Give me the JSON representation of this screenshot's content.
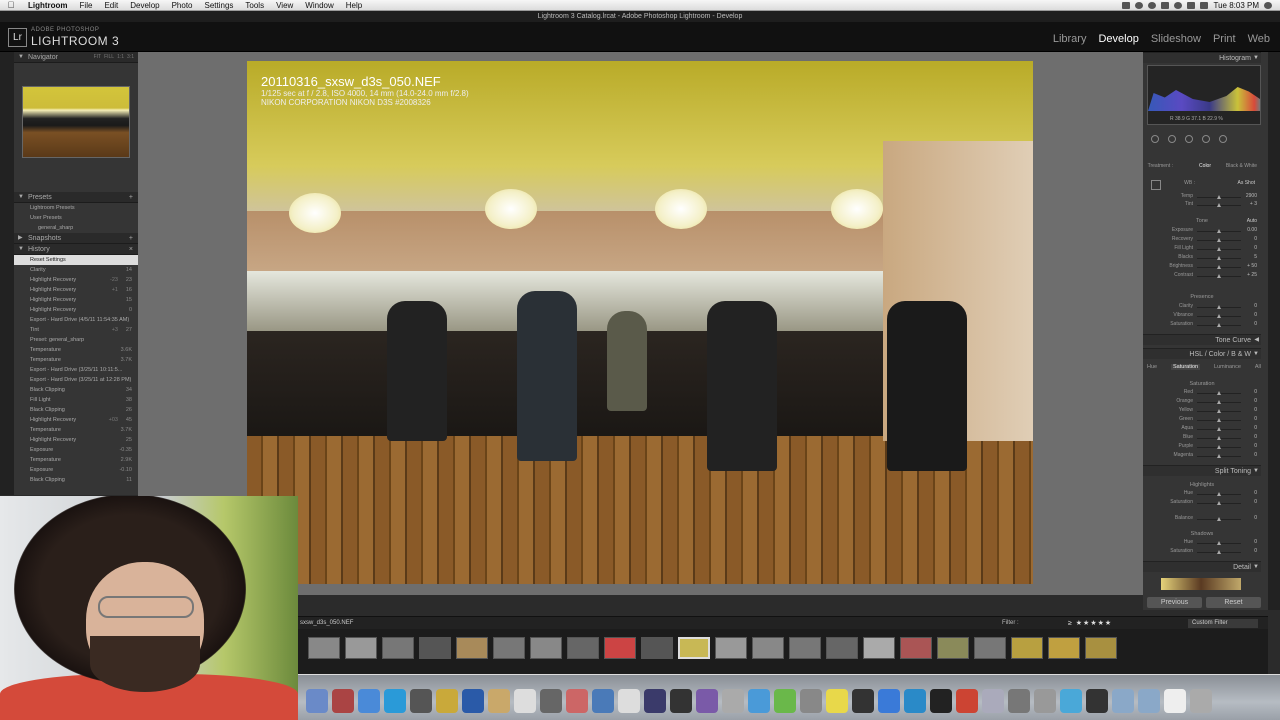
{
  "menubar": {
    "app": "Lightroom",
    "items": [
      "File",
      "Edit",
      "Develop",
      "Photo",
      "Settings",
      "Tools",
      "View",
      "Window",
      "Help"
    ],
    "clock": "Tue 8:03 PM"
  },
  "window": {
    "title": "Lightroom 3 Catalog.lrcat - Adobe Photoshop Lightroom - Develop"
  },
  "identity": {
    "small": "ADOBE PHOTOSHOP",
    "big": "LIGHTROOM 3",
    "logo": "Lr"
  },
  "modules": {
    "library": "Library",
    "develop": "Develop",
    "slideshow": "Slideshow",
    "print": "Print",
    "web": "Web"
  },
  "navigator": {
    "title": "Navigator",
    "fit": "FIT",
    "fill": "FILL",
    "one": "1:1",
    "ratio": "3:1"
  },
  "presets": {
    "title": "Presets",
    "items": [
      "Lightroom Presets",
      "User Presets",
      "general_sharp"
    ]
  },
  "snapshots": {
    "title": "Snapshots"
  },
  "history": {
    "title": "History",
    "items": [
      {
        "label": "Reset Settings",
        "v1": "",
        "v2": ""
      },
      {
        "label": "Clarity",
        "v1": "",
        "v2": "14"
      },
      {
        "label": "Highlight Recovery",
        "v1": "-23",
        "v2": "23"
      },
      {
        "label": "Highlight Recovery",
        "v1": "+1",
        "v2": "16"
      },
      {
        "label": "Highlight Recovery",
        "v1": "",
        "v2": "15"
      },
      {
        "label": "Highlight Recovery",
        "v1": "",
        "v2": "0"
      },
      {
        "label": "Export - Hard Drive (4/5/11 11:54:35 AM)",
        "v1": "",
        "v2": ""
      },
      {
        "label": "Tint",
        "v1": "+3",
        "v2": "27"
      },
      {
        "label": "Preset: general_sharp",
        "v1": "",
        "v2": ""
      },
      {
        "label": "Temperature",
        "v1": "",
        "v2": "3.6K"
      },
      {
        "label": "Temperature",
        "v1": "",
        "v2": "3.7K"
      },
      {
        "label": "Export - Hard Drive (3/25/11 10:11:5...",
        "v1": "",
        "v2": ""
      },
      {
        "label": "Export - Hard Drive (3/25/11 at 12:28 PM)",
        "v1": "",
        "v2": ""
      },
      {
        "label": "Black Clipping",
        "v1": "",
        "v2": "34"
      },
      {
        "label": "Fill Light",
        "v1": "",
        "v2": "38"
      },
      {
        "label": "Black Clipping",
        "v1": "",
        "v2": "26"
      },
      {
        "label": "Highlight Recovery",
        "v1": "+03",
        "v2": "45"
      },
      {
        "label": "Temperature",
        "v1": "",
        "v2": "3.7K"
      },
      {
        "label": "Highlight Recovery",
        "v1": "",
        "v2": "25"
      },
      {
        "label": "Exposure",
        "v1": "",
        "v2": "-0.35"
      },
      {
        "label": "Temperature",
        "v1": "",
        "v2": "2.9K"
      },
      {
        "label": "Exposure",
        "v1": "",
        "v2": "-0.10"
      },
      {
        "label": "Black Clipping",
        "v1": "",
        "v2": "11"
      }
    ]
  },
  "photo": {
    "filename": "20110316_sxsw_d3s_050.NEF",
    "exposure_line": "1/125 sec at f / 2.8, ISO 4000, 14 mm (14.0-24.0 mm f/2.8)",
    "camera_line": "NIKON CORPORATION NIKON D3S #2008326"
  },
  "histogram": {
    "title": "Histogram",
    "rgb": "R 38.9  G 37.1  B 22.9 %"
  },
  "basic": {
    "treatment": "Treatment :",
    "color": "Color",
    "bw": "Black & White",
    "wb": "WB :",
    "wb_value": "As Shot",
    "sliders": [
      {
        "label": "Temp",
        "value": "2900"
      },
      {
        "label": "Tint",
        "value": "+ 3"
      }
    ],
    "tone": "Tone",
    "auto": "Auto",
    "tone_sliders": [
      {
        "label": "Exposure",
        "value": "0.00"
      },
      {
        "label": "Recovery",
        "value": "0"
      },
      {
        "label": "Fill Light",
        "value": "0"
      },
      {
        "label": "Blacks",
        "value": "5"
      },
      {
        "label": "Brightness",
        "value": "+ 50"
      },
      {
        "label": "Contrast",
        "value": "+ 25"
      }
    ],
    "presence": "Presence",
    "presence_sliders": [
      {
        "label": "Clarity",
        "value": "0"
      },
      {
        "label": "Vibrance",
        "value": "0"
      },
      {
        "label": "Saturation",
        "value": "0"
      }
    ]
  },
  "tone_curve": {
    "title": "Tone Curve"
  },
  "hsl": {
    "title": "HSL  /  Color  /  B & W",
    "tabs": [
      "Hue",
      "Saturation",
      "Luminance",
      "All"
    ],
    "sub": "Saturation",
    "sliders": [
      {
        "label": "Red",
        "value": "0"
      },
      {
        "label": "Orange",
        "value": "0"
      },
      {
        "label": "Yellow",
        "value": "0"
      },
      {
        "label": "Green",
        "value": "0"
      },
      {
        "label": "Aqua",
        "value": "0"
      },
      {
        "label": "Blue",
        "value": "0"
      },
      {
        "label": "Purple",
        "value": "0"
      },
      {
        "label": "Magenta",
        "value": "0"
      }
    ]
  },
  "split_toning": {
    "title": "Split Toning",
    "highlights": "Highlights",
    "shadows": "Shadows",
    "rows_high": [
      {
        "label": "Hue",
        "value": "0"
      },
      {
        "label": "Saturation",
        "value": "0"
      }
    ],
    "balance": {
      "label": "Balance",
      "value": "0"
    },
    "rows_shadow": [
      {
        "label": "Hue",
        "value": "0"
      },
      {
        "label": "Saturation",
        "value": "0"
      }
    ]
  },
  "detail": {
    "title": "Detail"
  },
  "buttons": {
    "previous": "Previous",
    "reset": "Reset"
  },
  "filmstrip": {
    "filename": "sxsw_d3s_050.NEF",
    "filter": "Filter :",
    "rating": "≥ ★★★★★",
    "custom": "Custom Filter"
  }
}
